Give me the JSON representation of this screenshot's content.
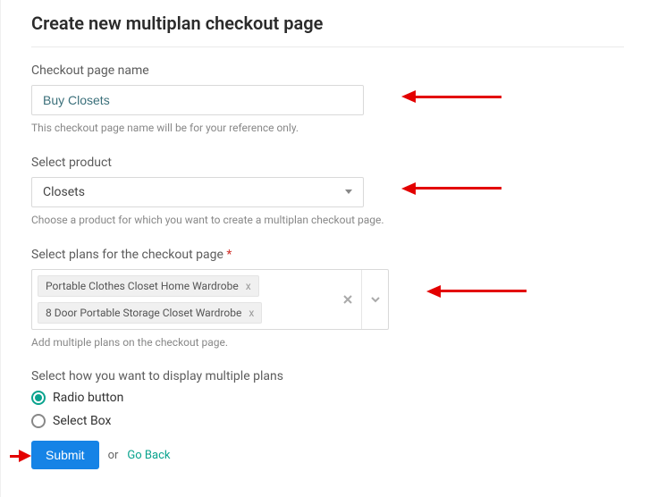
{
  "title": "Create new multiplan checkout page",
  "fields": {
    "name": {
      "label": "Checkout page name",
      "value": "Buy Closets",
      "help": "This checkout page name will be for your reference only."
    },
    "product": {
      "label": "Select product",
      "selected": "Closets",
      "help": "Choose a product for which you want to create a multiplan checkout page."
    },
    "plans": {
      "label": "Select plans for the checkout page",
      "required_mark": "*",
      "chips": [
        "Portable Clothes Closet Home Wardrobe",
        "8 Door Portable Storage Closet Wardrobe"
      ],
      "chip_remove": "x",
      "help": "Add multiple plans on the checkout page."
    },
    "display": {
      "label": "Select how you want to display multiple plans",
      "options": {
        "radio": "Radio button",
        "selectbox": "Select Box"
      },
      "selected": "radio"
    }
  },
  "actions": {
    "submit": "Submit",
    "or": "or",
    "goback": "Go Back"
  }
}
